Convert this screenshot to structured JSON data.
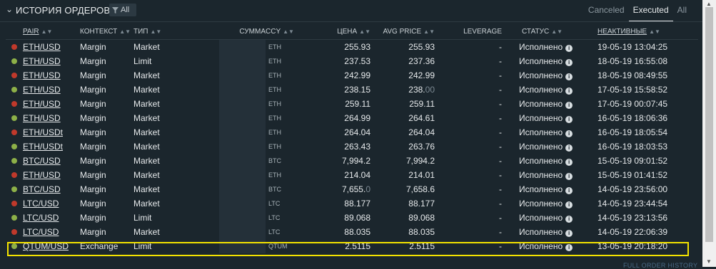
{
  "header": {
    "title": "ИСТОРИЯ ОРДЕРОВ",
    "filter_label": "All",
    "tabs": [
      "Canceled",
      "Executed",
      "All"
    ],
    "active_tab": "Executed"
  },
  "columns": {
    "pair": "PAIR",
    "context": "КОНТЕКСТ",
    "type": "ТИП",
    "amount": "СУММА",
    "ccy": "CCY",
    "price": "ЦЕНА",
    "avg_price": "AVG PRICE",
    "leverage": "LEVERAGE",
    "status": "СТАТУС",
    "inactive": "НЕАКТИВНЫЕ"
  },
  "colors": {
    "sell": "#c0392b",
    "buy": "#8db048",
    "highlight": "#f4e300"
  },
  "rows": [
    {
      "side": "sell",
      "pair": "ETH/USD",
      "context": "Margin",
      "type": "Market",
      "ccy": "ETH",
      "price": "255.93",
      "price_dim": "",
      "avg": "255.93",
      "avg_dim": "",
      "leverage": "-",
      "status": "Исполнено",
      "date": "19-05-19 13:04:25"
    },
    {
      "side": "buy",
      "pair": "ETH/USD",
      "context": "Margin",
      "type": "Limit",
      "ccy": "ETH",
      "price": "237.53",
      "price_dim": "",
      "avg": "237.36",
      "avg_dim": "",
      "leverage": "-",
      "status": "Исполнено",
      "date": "18-05-19 16:55:08"
    },
    {
      "side": "sell",
      "pair": "ETH/USD",
      "context": "Margin",
      "type": "Market",
      "ccy": "ETH",
      "price": "242.99",
      "price_dim": "",
      "avg": "242.99",
      "avg_dim": "",
      "leverage": "-",
      "status": "Исполнено",
      "date": "18-05-19 08:49:55"
    },
    {
      "side": "buy",
      "pair": "ETH/USD",
      "context": "Margin",
      "type": "Market",
      "ccy": "ETH",
      "price": "238.15",
      "price_dim": "",
      "avg": "238.",
      "avg_dim": "00",
      "leverage": "-",
      "status": "Исполнено",
      "date": "17-05-19 15:58:52"
    },
    {
      "side": "sell",
      "pair": "ETH/USD",
      "context": "Margin",
      "type": "Market",
      "ccy": "ETH",
      "price": "259.11",
      "price_dim": "",
      "avg": "259.11",
      "avg_dim": "",
      "leverage": "-",
      "status": "Исполнено",
      "date": "17-05-19 00:07:45"
    },
    {
      "side": "buy",
      "pair": "ETH/USD",
      "context": "Margin",
      "type": "Market",
      "ccy": "ETH",
      "price": "264.99",
      "price_dim": "",
      "avg": "264.61",
      "avg_dim": "",
      "leverage": "-",
      "status": "Исполнено",
      "date": "16-05-19 18:06:36"
    },
    {
      "side": "sell",
      "pair": "ETH/USDt",
      "context": "Margin",
      "type": "Market",
      "ccy": "ETH",
      "price": "264.04",
      "price_dim": "",
      "avg": "264.04",
      "avg_dim": "",
      "leverage": "-",
      "status": "Исполнено",
      "date": "16-05-19 18:05:54"
    },
    {
      "side": "buy",
      "pair": "ETH/USDt",
      "context": "Margin",
      "type": "Market",
      "ccy": "ETH",
      "price": "263.43",
      "price_dim": "",
      "avg": "263.76",
      "avg_dim": "",
      "leverage": "-",
      "status": "Исполнено",
      "date": "16-05-19 18:03:53"
    },
    {
      "side": "buy",
      "pair": "BTC/USD",
      "context": "Margin",
      "type": "Market",
      "ccy": "BTC",
      "price": "7,994.2",
      "price_dim": "",
      "avg": "7,994.2",
      "avg_dim": "",
      "leverage": "-",
      "status": "Исполнено",
      "date": "15-05-19 09:01:52"
    },
    {
      "side": "sell",
      "pair": "ETH/USD",
      "context": "Margin",
      "type": "Market",
      "ccy": "ETH",
      "price": "214.04",
      "price_dim": "",
      "avg": "214.01",
      "avg_dim": "",
      "leverage": "-",
      "status": "Исполнено",
      "date": "15-05-19 01:41:52"
    },
    {
      "side": "buy",
      "pair": "BTC/USD",
      "context": "Margin",
      "type": "Market",
      "ccy": "BTC",
      "price": "7,655.",
      "price_dim": "0",
      "avg": "7,658.6",
      "avg_dim": "",
      "leverage": "-",
      "status": "Исполнено",
      "date": "14-05-19 23:56:00"
    },
    {
      "side": "sell",
      "pair": "LTC/USD",
      "context": "Margin",
      "type": "Market",
      "ccy": "LTC",
      "price": "88.177",
      "price_dim": "",
      "avg": "88.177",
      "avg_dim": "",
      "leverage": "-",
      "status": "Исполнено",
      "date": "14-05-19 23:44:54"
    },
    {
      "side": "buy",
      "pair": "LTC/USD",
      "context": "Margin",
      "type": "Limit",
      "ccy": "LTC",
      "price": "89.068",
      "price_dim": "",
      "avg": "89.068",
      "avg_dim": "",
      "leverage": "-",
      "status": "Исполнено",
      "date": "14-05-19 23:13:56"
    },
    {
      "side": "sell",
      "pair": "LTC/USD",
      "context": "Margin",
      "type": "Market",
      "ccy": "LTC",
      "price": "88.035",
      "price_dim": "",
      "avg": "88.035",
      "avg_dim": "",
      "leverage": "-",
      "status": "Исполнено",
      "date": "14-05-19 22:06:39"
    },
    {
      "side": "buy",
      "pair": "QTUM/USD",
      "context": "Exchange",
      "type": "Limit",
      "ccy": "QTUM",
      "price": "2.5115",
      "price_dim": "",
      "avg": "2.5115",
      "avg_dim": "",
      "leverage": "-",
      "status": "Исполнено",
      "date": "13-05-19 20:18:20"
    }
  ],
  "footer_link": "FULL ORDER HISTORY"
}
